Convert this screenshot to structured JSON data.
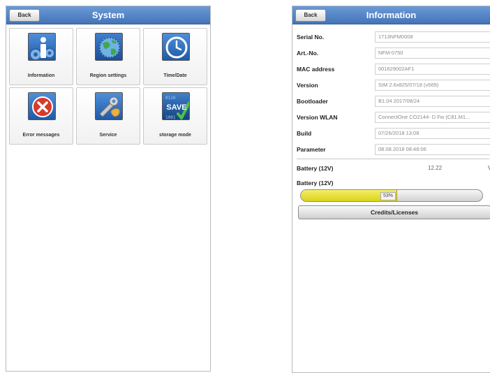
{
  "system": {
    "back_label": "Back",
    "title": "System",
    "tiles": [
      {
        "label": "Information",
        "icon": "info-gears-icon"
      },
      {
        "label": "Region settings",
        "icon": "globe-icon"
      },
      {
        "label": "Time/Date",
        "icon": "clock-icon"
      },
      {
        "label": "Error messages",
        "icon": "error-x-icon"
      },
      {
        "label": "Service",
        "icon": "service-tools-icon"
      },
      {
        "label": "storage mode",
        "icon": "save-icon"
      }
    ],
    "save_icon_text": "SAVE"
  },
  "information": {
    "back_label": "Back",
    "title": "Information",
    "rows": [
      {
        "label": "Serial No.",
        "value": "1713NFM0008"
      },
      {
        "label": "Art.-No.",
        "value": "NFM-0750"
      },
      {
        "label": "MAC address",
        "value": "001629002AF1"
      },
      {
        "label": "Version",
        "value": "SIM 2.6x825/07/18 (v569)"
      },
      {
        "label": "Bootloader",
        "value": "B1.04 2017/08/24"
      },
      {
        "label": "Version WLAN",
        "value": "ConnectOne CO2144- D Fw (C81.M1..."
      },
      {
        "label": "Build",
        "value": "07/26/2018 13:08"
      },
      {
        "label": "Parameter",
        "value": "08.08.2018 08:48:06"
      }
    ],
    "battery_voltage": {
      "label": "Battery (12V)",
      "value": "12.22",
      "unit": "V"
    },
    "battery_level": {
      "label": "Battery (12V)",
      "percent": 53,
      "text": "53%"
    },
    "credits_label": "Credits/Licenses"
  },
  "colors": {
    "titlebar": "#4f80c4",
    "progress_fill": "#e6de2c",
    "error_red": "#d83a2a"
  }
}
